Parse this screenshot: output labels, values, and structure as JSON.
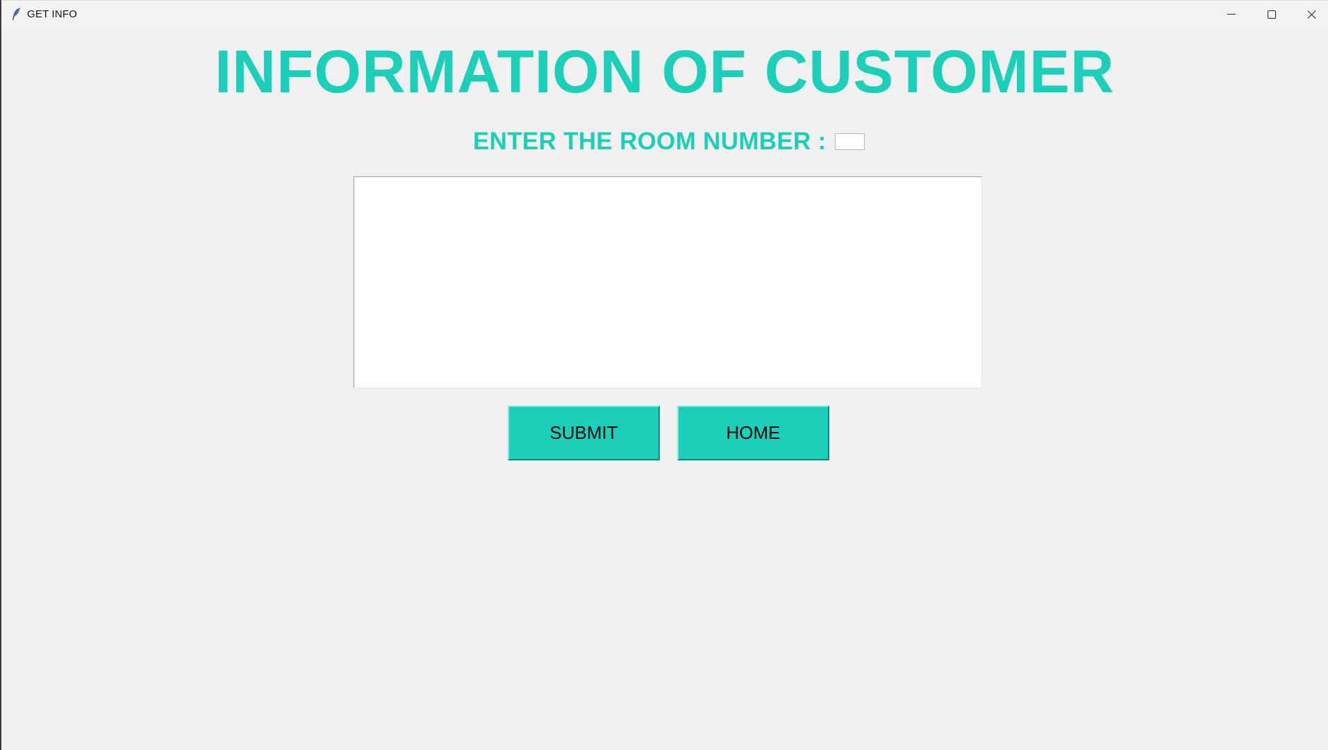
{
  "window": {
    "title": "GET INFO",
    "app_icon": "feather-icon",
    "controls": {
      "minimize_icon": "minimize-icon",
      "maximize_icon": "maximize-icon",
      "close_icon": "close-icon"
    }
  },
  "main": {
    "heading": "INFORMATION OF CUSTOMER",
    "room_label": "ENTER THE ROOM NUMBER :",
    "room_input_value": "",
    "info_text_value": "",
    "buttons": {
      "submit_label": "SUBMIT",
      "home_label": "HOME"
    }
  },
  "colors": {
    "accent": "#1ccfb8",
    "background": "#f0f0f0",
    "button_text": "#0a0a0a"
  }
}
